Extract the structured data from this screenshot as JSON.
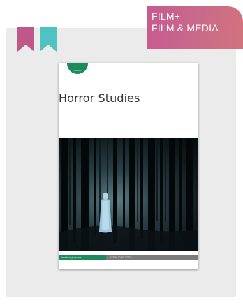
{
  "bookmarks": [
    {
      "name": "bookmark-pink",
      "color": "#c0578a"
    },
    {
      "name": "bookmark-teal",
      "color": "#4ec3c2"
    }
  ],
  "category": {
    "line1": "FILM+",
    "line2": "FILM & MEDIA"
  },
  "cover": {
    "title": "Horror Studies",
    "badge": "intellect",
    "publisher": "intellect journals",
    "issn": "ISSN 2040-3275",
    "accent": "#1d8a5e"
  }
}
